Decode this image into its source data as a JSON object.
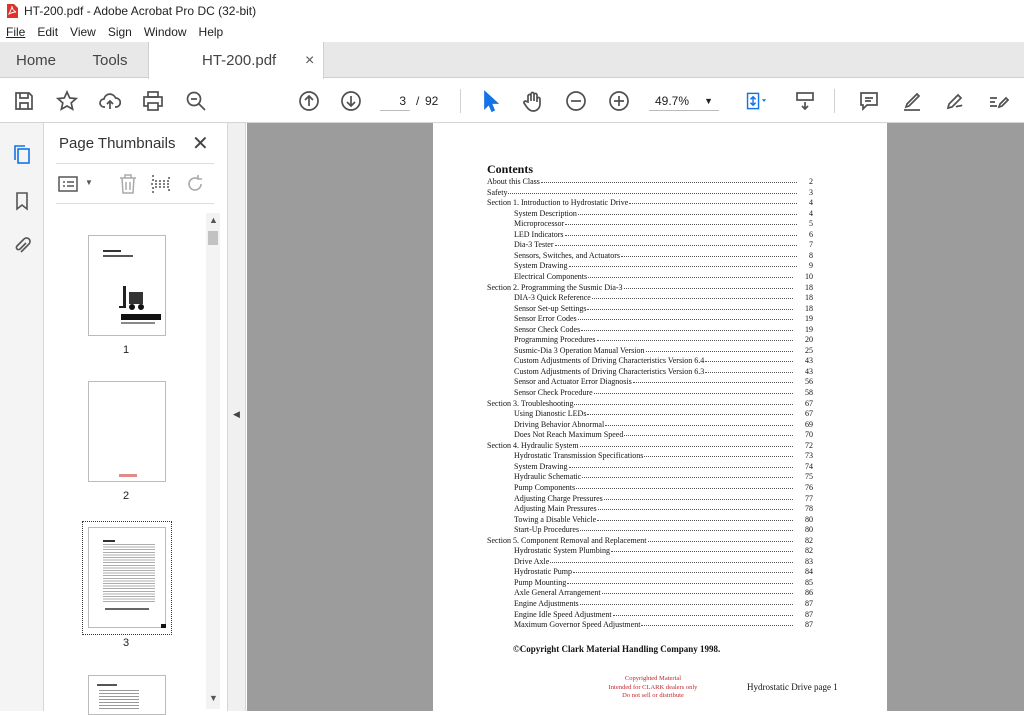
{
  "window": {
    "title": "HT-200.pdf - Adobe Acrobat Pro DC (32-bit)"
  },
  "menu": [
    "File",
    "Edit",
    "View",
    "Sign",
    "Window",
    "Help"
  ],
  "tabs": {
    "home": "Home",
    "tools": "Tools",
    "doc": "HT-200.pdf",
    "close": "×"
  },
  "toolbar": {
    "current_page": "3",
    "page_sep": "/",
    "total_pages": "92",
    "zoom": "49.7%"
  },
  "panel": {
    "title": "Page Thumbnails",
    "thumbs": [
      {
        "label": "1"
      },
      {
        "label": "2"
      },
      {
        "label": "3"
      }
    ]
  },
  "document": {
    "heading": "Contents",
    "toc": [
      {
        "t": "About this Class",
        "p": "2",
        "i": 0
      },
      {
        "t": "Safety",
        "p": "3",
        "i": 0
      },
      {
        "t": "Section 1. Introduction to Hydrostatic Drive",
        "p": "4",
        "i": 0
      },
      {
        "t": "System Description",
        "p": "4",
        "i": 1
      },
      {
        "t": "Microprocessor",
        "p": "5",
        "i": 1
      },
      {
        "t": "LED Indicators",
        "p": "6",
        "i": 1
      },
      {
        "t": "Dia-3 Tester",
        "p": "7",
        "i": 1
      },
      {
        "t": "Sensors, Switches, and Actuators",
        "p": "8",
        "i": 1
      },
      {
        "t": "System Drawing",
        "p": "9",
        "i": 1
      },
      {
        "t": "Electrical Components",
        "p": "10",
        "i": 1
      },
      {
        "t": "Section 2. Programming the Susmic Dia-3",
        "p": "18",
        "i": 0
      },
      {
        "t": "DIA-3 Quick Reference",
        "p": "18",
        "i": 1
      },
      {
        "t": "Sensor Set-up Settings",
        "p": "18",
        "i": 1
      },
      {
        "t": "Sensor Error Codes",
        "p": "19",
        "i": 1
      },
      {
        "t": "Sensor Check Codes",
        "p": "19",
        "i": 1
      },
      {
        "t": "Programming Procedures",
        "p": "20",
        "i": 1
      },
      {
        "t": "Susmic-Dia 3 Operation Manual Version",
        "p": "25",
        "i": 1
      },
      {
        "t": "Custom Adjustments of Driving Characteristics Version 6.4",
        "p": "43",
        "i": 1
      },
      {
        "t": "Custom Adjustments of Driving Characteristics Version 6.3",
        "p": "43",
        "i": 1
      },
      {
        "t": "Sensor and Actuator Error Diagnosis",
        "p": "56",
        "i": 1
      },
      {
        "t": "Sensor Check Procedure",
        "p": "58",
        "i": 1
      },
      {
        "t": "Section 3. Troubleshooting",
        "p": "67",
        "i": 0
      },
      {
        "t": "Using Dianostic LEDs",
        "p": "67",
        "i": 1
      },
      {
        "t": "Driving Behavior Abnormal",
        "p": "69",
        "i": 1
      },
      {
        "t": "Does Not Reach Maximum Speed",
        "p": "70",
        "i": 1
      },
      {
        "t": "Section 4. Hydraulic System",
        "p": "72",
        "i": 0
      },
      {
        "t": "Hydrostatic Transmission Specifications",
        "p": "73",
        "i": 1
      },
      {
        "t": "System Drawing",
        "p": "74",
        "i": 1
      },
      {
        "t": "Hydraulic Schematic",
        "p": "75",
        "i": 1
      },
      {
        "t": "Pump Components",
        "p": "76",
        "i": 1
      },
      {
        "t": "Adjusting Charge Pressures",
        "p": "77",
        "i": 1
      },
      {
        "t": "Adjusting  Main Pressures",
        "p": "78",
        "i": 1
      },
      {
        "t": "Towing a Disable Vehicle",
        "p": "80",
        "i": 1
      },
      {
        "t": "Start-Up Procedures",
        "p": "80",
        "i": 1
      },
      {
        "t": "Section 5. Component Removal and Replacement",
        "p": "82",
        "i": 0
      },
      {
        "t": "Hydrostatic System Plumbing",
        "p": "82",
        "i": 1
      },
      {
        "t": "Drive Axle",
        "p": "83",
        "i": 1
      },
      {
        "t": "Hydrostatic Pump",
        "p": "84",
        "i": 1
      },
      {
        "t": "Pump Mounting",
        "p": "85",
        "i": 1
      },
      {
        "t": "Axle General Arrangement",
        "p": "86",
        "i": 1
      },
      {
        "t": "Engine Adjustments",
        "p": "87",
        "i": 1
      },
      {
        "t": "Engine Idle Speed Adjustment",
        "p": "87",
        "i": 1
      },
      {
        "t": "Maximum Governor Speed Adjustment",
        "p": "87",
        "i": 1
      }
    ],
    "copyright": "©Copyright Clark Material Handling Company 1998.",
    "stamp": [
      "Copyrighted Material",
      "Intended for CLARK dealers only",
      "Do not sell or distribute"
    ],
    "footer": "Hydrostatic Drive page 1"
  },
  "colors": {
    "accent": "#1473e6",
    "stamp_red": "#c0262d"
  }
}
